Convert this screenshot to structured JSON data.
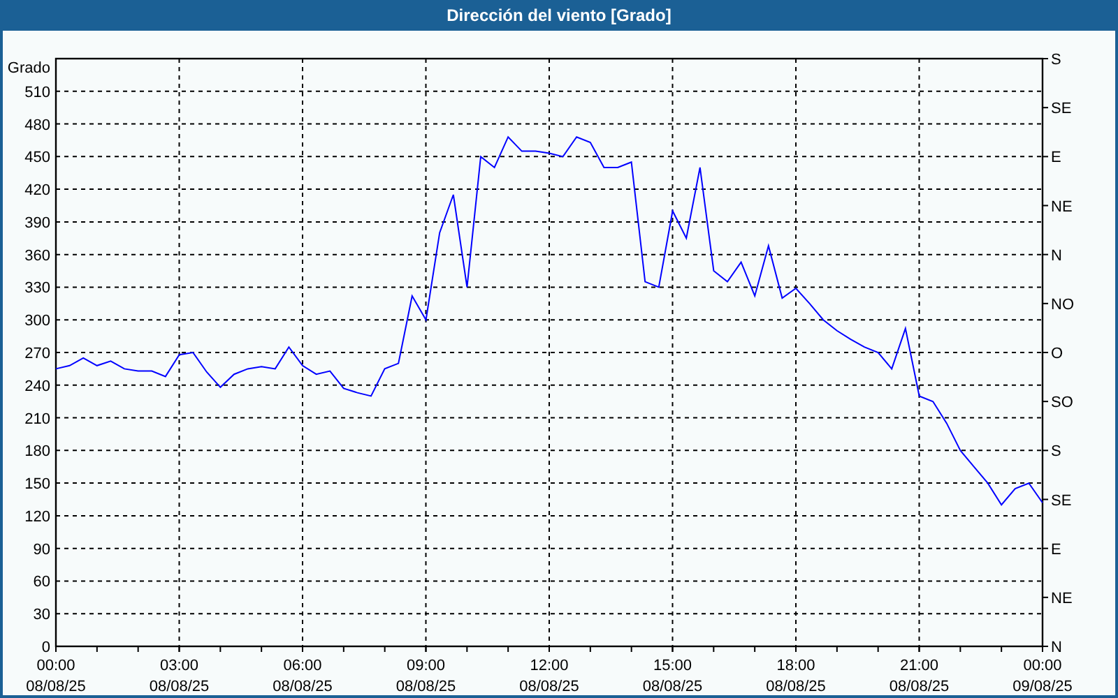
{
  "window": {
    "title": "Dirección del viento [Grado]"
  },
  "chart": {
    "chart_data": {
      "type": "line",
      "grid": true,
      "ylabel": "Grado",
      "ylim": [
        0,
        540
      ],
      "categories": [
        "00:00\n08/08/25",
        null,
        null,
        null,
        null,
        null,
        null,
        null,
        null,
        "03:00\n08/08/25",
        null,
        null,
        null,
        null,
        null,
        null,
        null,
        null,
        "06:00\n08/08/25",
        null,
        null,
        null,
        null,
        null,
        null,
        null,
        null,
        "09:00\n08/08/25",
        null,
        null,
        null,
        null,
        null,
        null,
        null,
        null,
        "12:00\n08/08/25",
        null,
        null,
        null,
        null,
        null,
        null,
        null,
        null,
        "15:00\n08/08/25",
        null,
        null,
        null,
        null,
        null,
        null,
        null,
        null,
        "18:00\n08/08/25",
        null,
        null,
        null,
        null,
        null,
        null,
        null,
        null,
        "21:00\n08/08/25",
        null,
        null,
        null,
        null,
        null,
        null,
        null,
        null,
        "00:00\n09/08/25"
      ],
      "yticks": [
        0,
        30,
        60,
        90,
        120,
        150,
        180,
        210,
        240,
        270,
        300,
        330,
        360,
        390,
        420,
        450,
        480,
        510
      ],
      "series": [
        {
          "color": "#0000ff",
          "values": [
            255,
            258,
            265,
            258,
            262,
            255,
            253,
            253,
            248,
            268,
            270,
            252,
            238,
            250,
            255,
            257,
            255,
            275,
            258,
            250,
            253,
            237,
            233,
            230,
            255,
            260,
            322,
            300,
            380,
            415,
            330,
            450,
            440,
            468,
            455,
            455,
            453,
            450,
            468,
            463,
            440,
            440,
            445,
            335,
            330,
            400,
            375,
            440,
            345,
            335,
            353,
            322,
            368,
            320,
            329,
            315,
            300,
            290,
            282,
            275,
            270,
            255,
            292,
            230,
            225,
            205,
            180,
            165,
            150,
            130,
            145,
            150,
            132
          ]
        }
      ]
    },
    "right_axis": {
      "labels": [
        "S",
        "SE",
        "E",
        "NE",
        "N",
        "NO",
        "O",
        "SO",
        "S",
        "SE",
        "E",
        "NE",
        "N"
      ]
    }
  }
}
